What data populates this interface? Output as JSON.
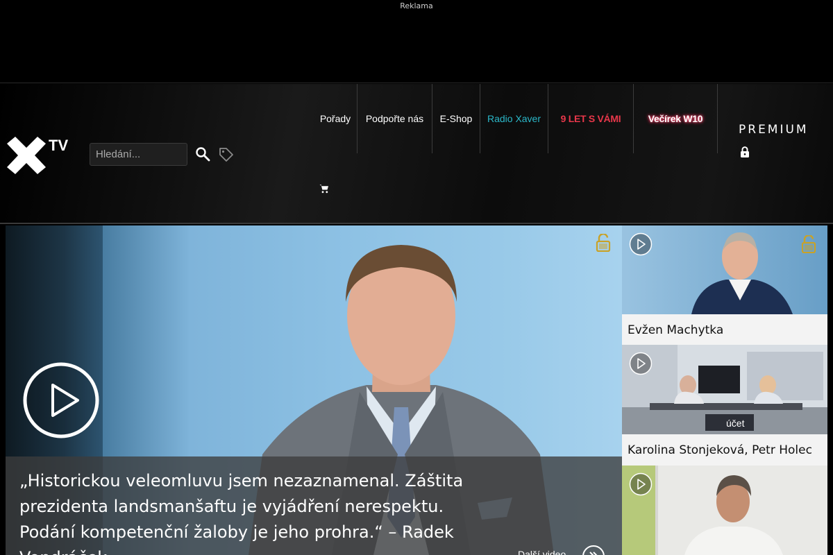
{
  "ad": {
    "label": "Reklama"
  },
  "header": {
    "logo_text": "TV",
    "search_placeholder": "Hledání...",
    "nav": [
      {
        "label": "Pořady"
      },
      {
        "label": "Podpořte nás"
      },
      {
        "label": "E-Shop"
      },
      {
        "label": "Radio Xaver"
      },
      {
        "label": "9 LET S VÁMI"
      },
      {
        "label": "Večírek W10"
      }
    ],
    "premium_label": "PREMIUM"
  },
  "hero": {
    "caption": "„Historickou veleomluvu jsem nezaznamenal. Záštita prezidenta landsmanšaftu je vyjádření nerespektu. Podání kompetenční žaloby je jeho prohra.“ – Radek Vondráček",
    "more_label": "Další video"
  },
  "sidebar": {
    "cards": [
      {
        "title": "Evžen Machytka",
        "locked": true
      },
      {
        "title": "Karolina Stonjeková, Petr Holec",
        "locked": false
      },
      {
        "title": "",
        "locked": false
      }
    ]
  },
  "colors": {
    "accent_radio": "#2bb8c9",
    "accent_9let": "#e8374a",
    "lock_gold": "#c9a227"
  }
}
